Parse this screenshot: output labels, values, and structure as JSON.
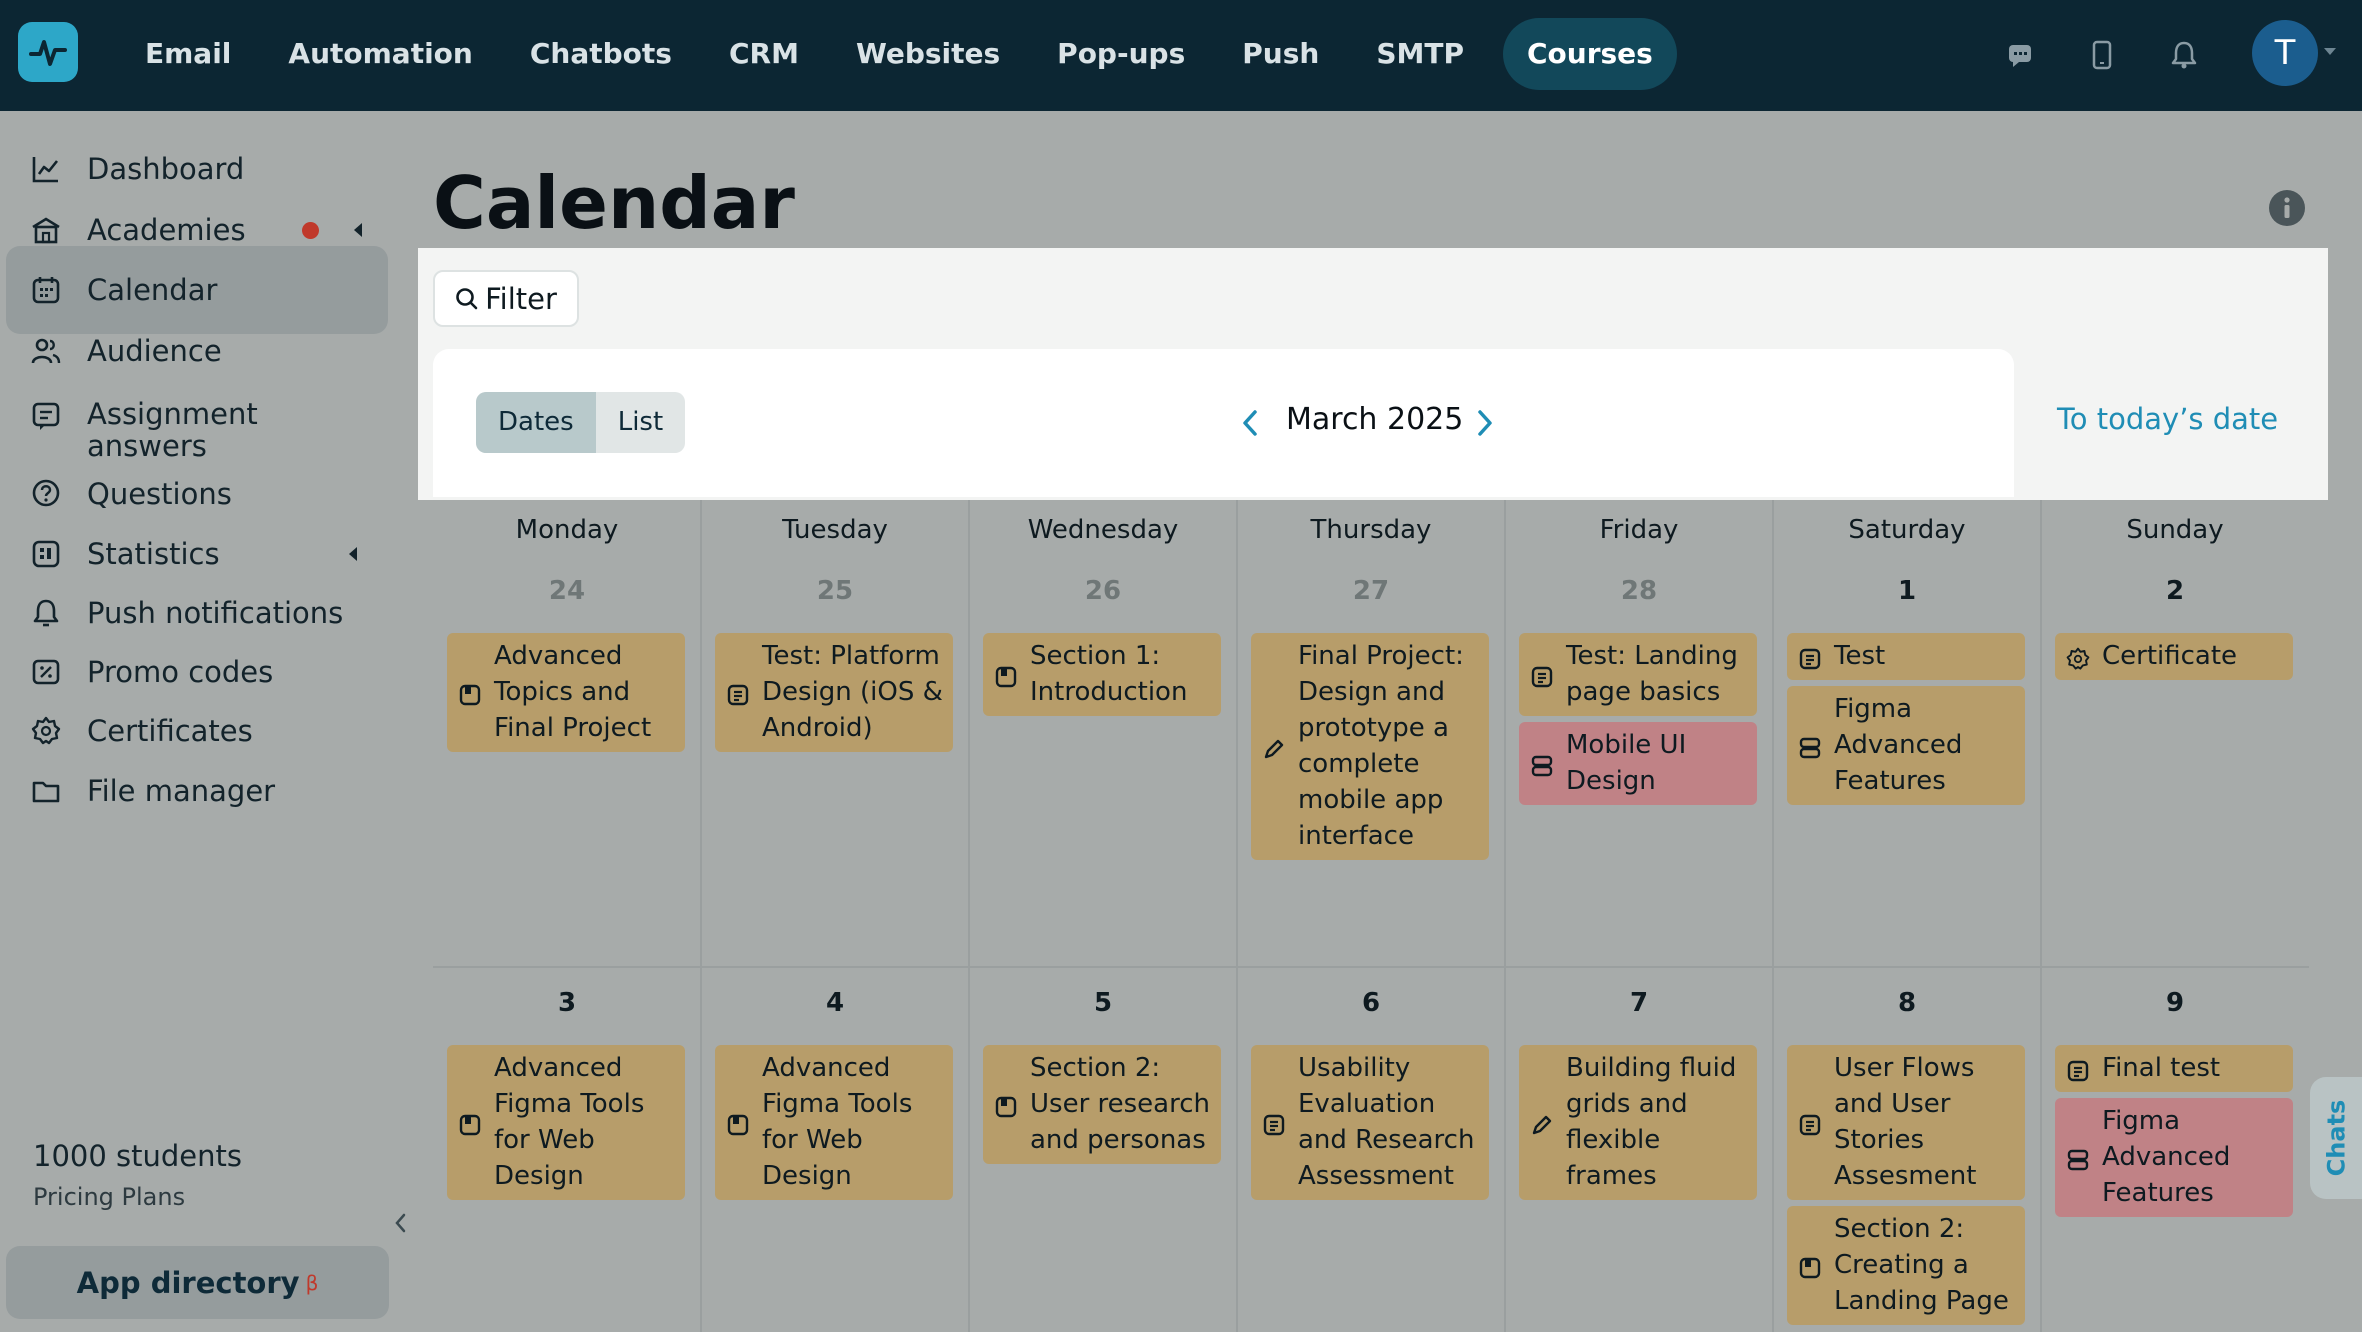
{
  "topnav": {
    "items": [
      "Email",
      "Automation",
      "Chatbots",
      "CRM",
      "Websites",
      "Pop-ups",
      "Push",
      "SMTP",
      "Courses"
    ],
    "active_item": "Courses",
    "avatar_letter": "T"
  },
  "sidebar": {
    "items": [
      {
        "label": "Dashboard",
        "icon": "chart-line-icon"
      },
      {
        "label": "Academies",
        "icon": "academy-building-icon"
      },
      {
        "label": "Calendar",
        "icon": "calendar-icon"
      },
      {
        "label": "Audience",
        "icon": "users-icon"
      },
      {
        "label": "Assignment answers",
        "icon": "assignment-icon"
      },
      {
        "label": "Questions",
        "icon": "question-circle-icon"
      },
      {
        "label": "Statistics",
        "icon": "statistics-icon"
      },
      {
        "label": "Push notifications",
        "icon": "bell-icon"
      },
      {
        "label": "Promo codes",
        "icon": "promo-code-icon"
      },
      {
        "label": "Certificates",
        "icon": "certificate-icon"
      },
      {
        "label": "File manager",
        "icon": "folder-icon"
      }
    ],
    "active_item": "Calendar",
    "students": "1000 students",
    "pricing": "Pricing Plans",
    "app_directory": "App directory",
    "app_directory_badge": "β"
  },
  "page": {
    "title": "Calendar",
    "filter_label": "Filter",
    "view_toggle": [
      "Dates",
      "List"
    ],
    "active_view": "Dates",
    "month": "March 2025",
    "today_link": "To today’s date"
  },
  "calendar": {
    "weekdays": [
      "Monday",
      "Tuesday",
      "Wednesday",
      "Thursday",
      "Friday",
      "Saturday",
      "Sunday"
    ],
    "weeks": [
      {
        "days": [
          {
            "num": "24",
            "muted": true,
            "events": [
              {
                "title": "Advanced Topics and Final Project",
                "icon": "lesson-icon",
                "color": "tan"
              }
            ]
          },
          {
            "num": "25",
            "muted": true,
            "events": [
              {
                "title": "Test: Platform Design (iOS & Android)",
                "icon": "test-icon",
                "color": "tan"
              }
            ]
          },
          {
            "num": "26",
            "muted": true,
            "events": [
              {
                "title": "Section 1: Introduction",
                "icon": "lesson-icon",
                "color": "tan"
              }
            ]
          },
          {
            "num": "27",
            "muted": true,
            "events": [
              {
                "title": "Final Project: Design and prototype a complete mobile app interface",
                "icon": "pencil-icon",
                "color": "tan"
              }
            ]
          },
          {
            "num": "28",
            "muted": true,
            "events": [
              {
                "title": "Test: Landing page basics",
                "icon": "test-icon",
                "color": "tan"
              },
              {
                "title": "Mobile UI Design",
                "icon": "course-icon",
                "color": "pink"
              }
            ]
          },
          {
            "num": "1",
            "muted": false,
            "events": [
              {
                "title": "Test",
                "icon": "test-icon",
                "color": "tan"
              },
              {
                "title": "Figma Advanced Features",
                "icon": "course-icon",
                "color": "tan"
              }
            ]
          },
          {
            "num": "2",
            "muted": false,
            "events": [
              {
                "title": "Certificate",
                "icon": "certificate-icon",
                "color": "tan"
              }
            ]
          }
        ]
      },
      {
        "days": [
          {
            "num": "3",
            "muted": false,
            "events": [
              {
                "title": "Advanced Figma Tools for Web Design",
                "icon": "lesson-icon",
                "color": "tan"
              }
            ]
          },
          {
            "num": "4",
            "muted": false,
            "events": [
              {
                "title": "Advanced Figma Tools for Web Design",
                "icon": "lesson-icon",
                "color": "tan"
              }
            ]
          },
          {
            "num": "5",
            "muted": false,
            "events": [
              {
                "title": "Section 2: User research and personas",
                "icon": "lesson-icon",
                "color": "tan"
              }
            ]
          },
          {
            "num": "6",
            "muted": false,
            "events": [
              {
                "title": "Usability Evaluation and Research Assessment",
                "icon": "test-icon",
                "color": "tan"
              }
            ]
          },
          {
            "num": "7",
            "muted": false,
            "events": [
              {
                "title": "Building fluid grids and flexible frames",
                "icon": "pencil-icon",
                "color": "tan"
              }
            ]
          },
          {
            "num": "8",
            "muted": false,
            "events": [
              {
                "title": "User Flows and User Stories Assesment",
                "icon": "test-icon",
                "color": "tan"
              },
              {
                "title": "Section 2: Creating a Landing Page",
                "icon": "lesson-icon",
                "color": "tan"
              }
            ]
          },
          {
            "num": "9",
            "muted": false,
            "events": [
              {
                "title": "Final test",
                "icon": "test-icon",
                "color": "tan"
              },
              {
                "title": "Figma Advanced Features",
                "icon": "course-icon",
                "color": "pink"
              }
            ]
          }
        ]
      }
    ]
  },
  "chats_tab": "Chats",
  "colors": {
    "nav_bg": "#0c2633",
    "overlay": "#a7abaa",
    "event_tan": "#b79d6a",
    "event_pink": "#c08286",
    "link": "#1f8db5",
    "accent_dot": "#c0392b"
  }
}
